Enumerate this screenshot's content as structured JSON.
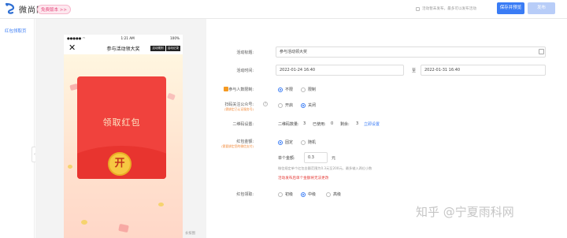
{
  "header": {
    "logo_text": "微尚网",
    "version_badge": "免费版本 >>",
    "auto_save_label": "活动暂未发布，最多可以发布活动",
    "save_button": "保存并预览",
    "publish_button": "发布"
  },
  "sidebar": {
    "items": [
      {
        "label": "红包领取页"
      }
    ]
  },
  "phone": {
    "status_time": "1:21 AM",
    "status_battery": "100%",
    "title": "参与活动领大奖",
    "tags": [
      "活动规则",
      "活动记录"
    ],
    "envelope_title": "领取红包",
    "open_button": "开"
  },
  "canvas_footer": "长按图",
  "form": {
    "activity_title": {
      "label": "活动标题:",
      "value": "参与活动领大奖"
    },
    "activity_time": {
      "label": "活动时间:",
      "start": "2022-01-24 16:40",
      "separator": "至",
      "end": "2022-01-31 16:40"
    },
    "participant_limit": {
      "label": "参与人数限制:",
      "options": [
        "不限",
        "限制"
      ],
      "selected": 0
    },
    "follow_account": {
      "label": "扫码关注公众号:",
      "sublabel": "(需绑定已认证服务号)",
      "options": [
        "开启",
        "关闭"
      ],
      "selected": 1
    },
    "qrcode": {
      "label": "二维码设置:",
      "count_label": "二维码数量:",
      "count": "3",
      "used_label": "已使用:",
      "used": "0",
      "remaining_label": "剩余:",
      "remaining": "3",
      "link": "立即设置"
    },
    "amount": {
      "label": "红包金额:",
      "sublabel": "(需要绑定您的微信支付)",
      "options": [
        "固定",
        "随机"
      ],
      "selected": 0,
      "single_label": "单个金额:",
      "single_value": "0.3",
      "unit": "元",
      "hint": "微信规定单个红包金额范围为0.3元至200元，最多输入两位小数",
      "warning": "活动发布后单个金额将无法更改"
    },
    "period": {
      "label": "红包领取:",
      "options": [
        "初级",
        "中级",
        "高级"
      ],
      "selected": 1
    }
  },
  "watermark": "知乎 @宁夏雨科网",
  "colors": {
    "accent": "#3a7cf5",
    "envelope": "#f0423d",
    "warning": "#e53935",
    "coin": "#f7c842"
  }
}
